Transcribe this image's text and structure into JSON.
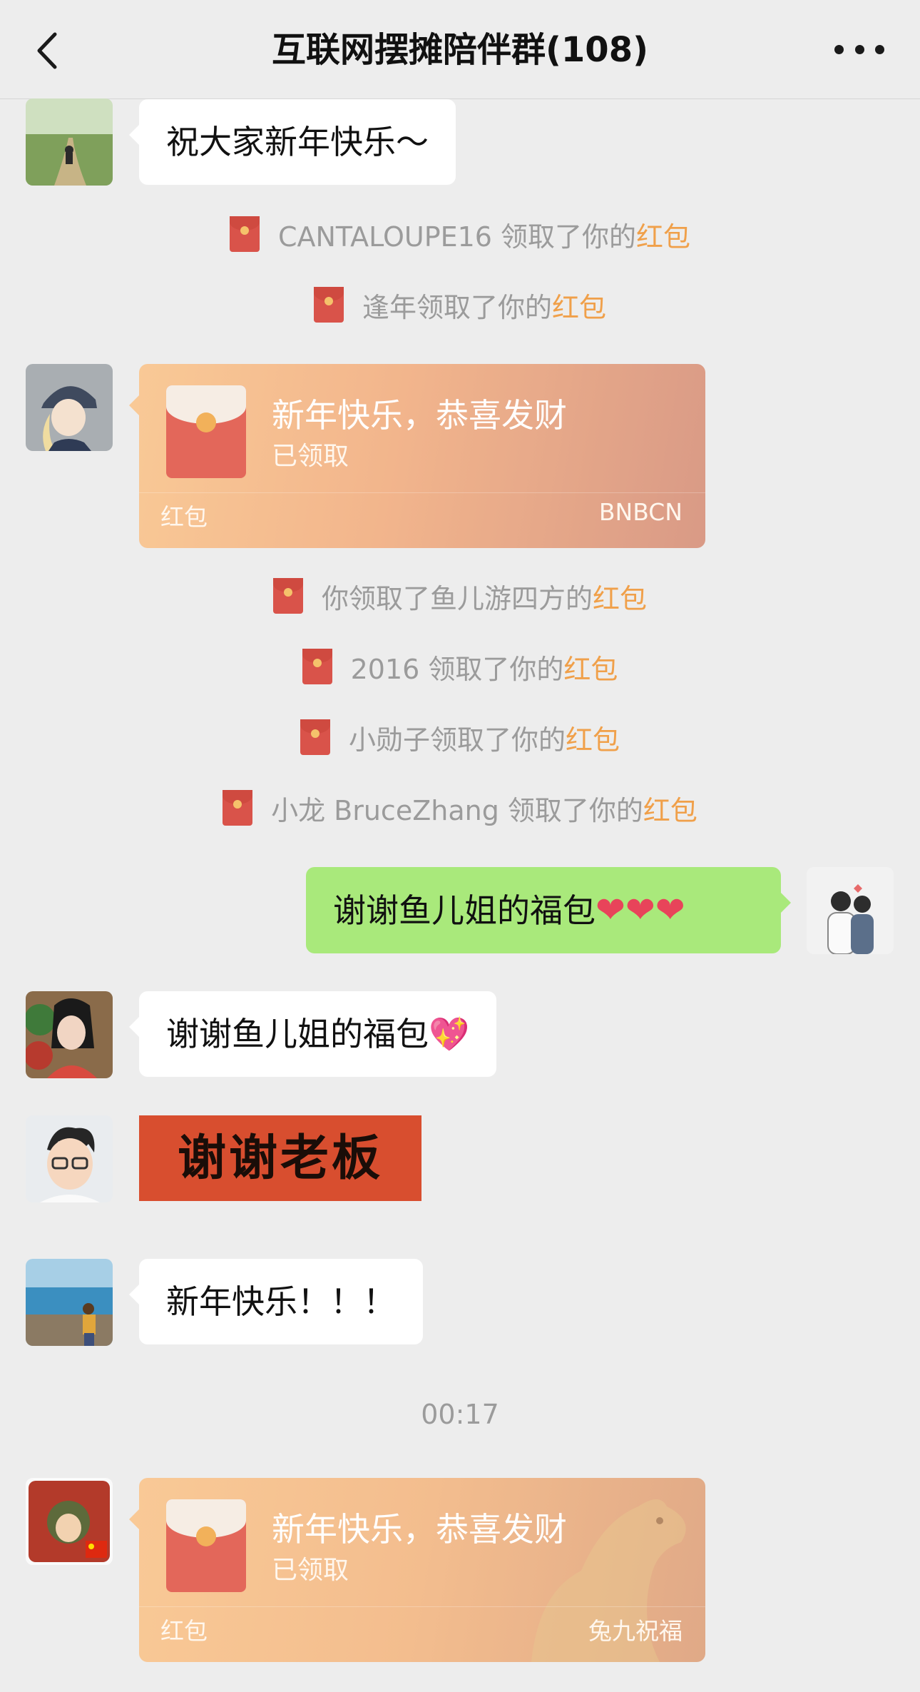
{
  "header": {
    "title": "互联网摆摊陪伴群(108)",
    "back_icon": "chevron-left-icon",
    "more_icon": "more-dots-icon"
  },
  "messages": {
    "m1_text": "祝大家新年快乐～",
    "sys1": {
      "before": "CANTALOUPE16 领取了你的",
      "link": "红包"
    },
    "sys2": {
      "before": "逢年领取了你的",
      "link": "红包"
    },
    "packet1": {
      "title": "新年快乐，恭喜发财",
      "status": "已领取",
      "label": "红包",
      "source": "BNBCN"
    },
    "sys3": {
      "before": "你领取了鱼儿游四方的",
      "link": "红包"
    },
    "sys4": {
      "before": "2016 领取了你的",
      "link": "红包"
    },
    "sys5": {
      "before": "小勋子领取了你的",
      "link": "红包"
    },
    "sys6": {
      "before": "小龙 BruceZhang 领取了你的",
      "link": "红包"
    },
    "m2_text": "谢谢鱼儿姐的福包",
    "m2_emoji": "❤❤❤",
    "m3_text": "谢谢鱼儿姐的福包",
    "m3_emoji": "💖",
    "sticker_text": "谢谢老板",
    "m4_text": "新年快乐！！！",
    "time": "00:17",
    "packet2": {
      "title": "新年快乐，恭喜发财",
      "status": "已领取",
      "label": "红包",
      "source": "兔九祝福"
    }
  },
  "colors": {
    "bg": "#ededed",
    "my_bubble": "#a9e97b",
    "link_orange": "#f0a04a",
    "packet": "#f2b58c"
  }
}
